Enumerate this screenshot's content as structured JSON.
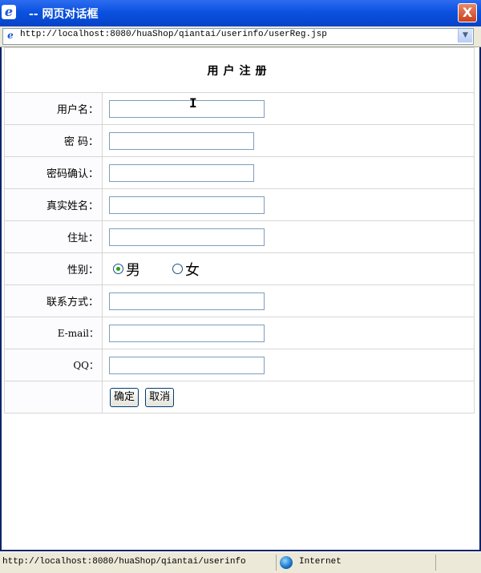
{
  "window": {
    "title": "-- 网页对话框",
    "close_label": "X"
  },
  "address": {
    "url": "http://localhost:8080/huaShop/qiantai/userinfo/userReg.jsp"
  },
  "form": {
    "heading": "用户注册",
    "fields": {
      "username": "用户名：",
      "password": "密 码：",
      "confirm": "密码确认：",
      "realname": "真实姓名：",
      "address": "住址：",
      "gender": "性别：",
      "contact": "联系方式：",
      "email": "E-mail：",
      "qq": "QQ："
    },
    "gender_options": {
      "male": "男",
      "female": "女",
      "selected": "男"
    },
    "buttons": {
      "ok": "确定",
      "cancel": "取消"
    }
  },
  "status": {
    "text": "http://localhost:8080/huaShop/qiantai/userinfo",
    "zone": "Internet"
  }
}
